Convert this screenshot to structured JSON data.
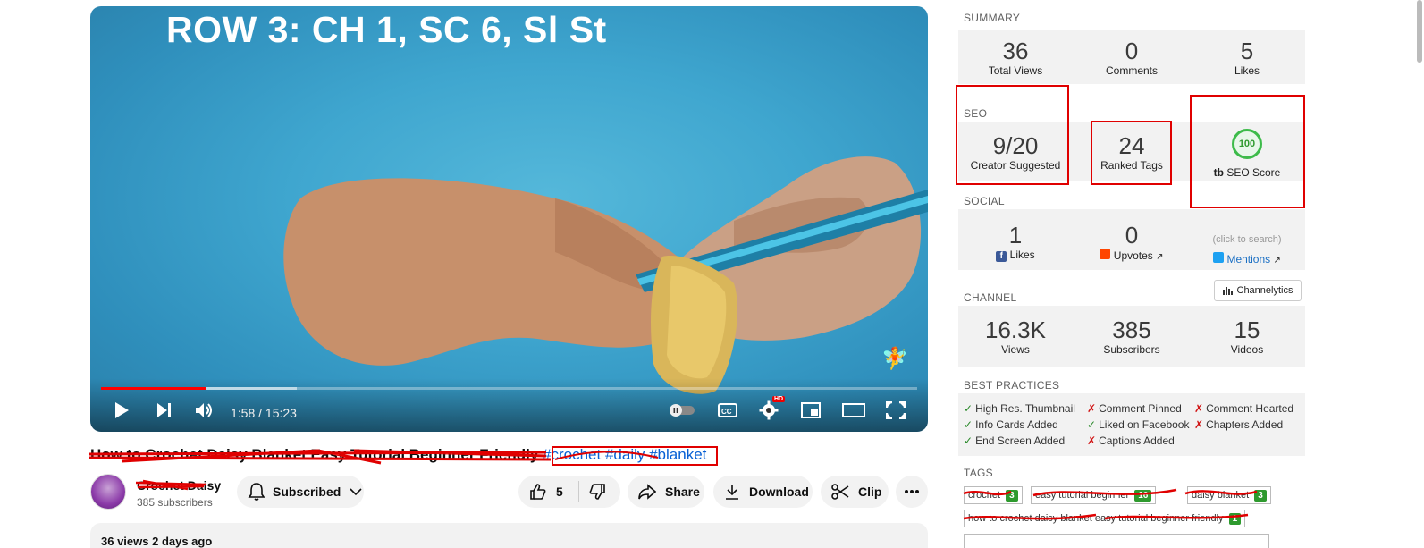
{
  "player": {
    "overlay_title": "ROW 3: CH 1, SC 6, Sl St",
    "time": "1:58 / 15:23",
    "progress_fraction": 0.128,
    "buffer_fraction": 0.24,
    "hd_badge": "HD"
  },
  "video": {
    "title": "How to Crochet Daisy Blanket Easy Tutorial Beginner Friendly",
    "hashtags": "#crochet #daily #blanket",
    "channel_name": "Crochet Daisy",
    "channel_subs": "385 subscribers",
    "subscribe_label": "Subscribed",
    "like_count": "5",
    "share_label": "Share",
    "download_label": "Download",
    "clip_label": "Clip",
    "description_preview": "36 views  2 days ago"
  },
  "panel": {
    "summary_label": "SUMMARY",
    "summary": [
      {
        "num": "36",
        "lbl": "Total Views"
      },
      {
        "num": "0",
        "lbl": "Comments"
      },
      {
        "num": "5",
        "lbl": "Likes"
      }
    ],
    "seo_label": "SEO",
    "seo": [
      {
        "num": "9/20",
        "lbl": "Creator Suggested"
      },
      {
        "num": "24",
        "lbl": "Ranked Tags"
      }
    ],
    "seo_score": {
      "num": "100",
      "lbl": "SEO Score"
    },
    "social_label": "SOCIAL",
    "social": [
      {
        "num": "1",
        "lbl": "Likes"
      },
      {
        "num": "0",
        "lbl": "Upvotes"
      }
    ],
    "mentions_hint": "(click to search)",
    "mentions_label": "Mentions",
    "channel_label": "CHANNEL",
    "channelytics_label": "Channelytics",
    "channel": [
      {
        "num": "16.3K",
        "lbl": "Views"
      },
      {
        "num": "385",
        "lbl": "Subscribers"
      },
      {
        "num": "15",
        "lbl": "Videos"
      }
    ],
    "best_practices_label": "BEST PRACTICES",
    "best_practices": [
      {
        "mark": "✓",
        "text": "High Res. Thumbnail",
        "ok": true
      },
      {
        "mark": "✗",
        "text": "Comment Pinned",
        "ok": false
      },
      {
        "mark": "✗",
        "text": "Comment Hearted",
        "ok": false
      },
      {
        "mark": "✓",
        "text": "Info Cards Added",
        "ok": true
      },
      {
        "mark": "✓",
        "text": "Liked on Facebook",
        "ok": true
      },
      {
        "mark": "✗",
        "text": "Chapters Added",
        "ok": false
      },
      {
        "mark": "✓",
        "text": "End Screen Added",
        "ok": true
      },
      {
        "mark": "✗",
        "text": "Captions Added",
        "ok": false
      }
    ],
    "tags_label": "TAGS",
    "tags": [
      {
        "text": "crochet",
        "count": "3"
      },
      {
        "text": "easy tutorial beginner",
        "count": "16"
      },
      {
        "text": "daisy blanket",
        "count": "3"
      },
      {
        "text": "how to crochet daisy blanket easy tutorial beginner friendly",
        "count": "1"
      }
    ]
  },
  "colors": {
    "highlight_red": "#e00000",
    "progress_red": "#ff0000",
    "check_green": "#2a8a2a",
    "cross_red": "#d01010",
    "link_blue": "#065fd4"
  }
}
